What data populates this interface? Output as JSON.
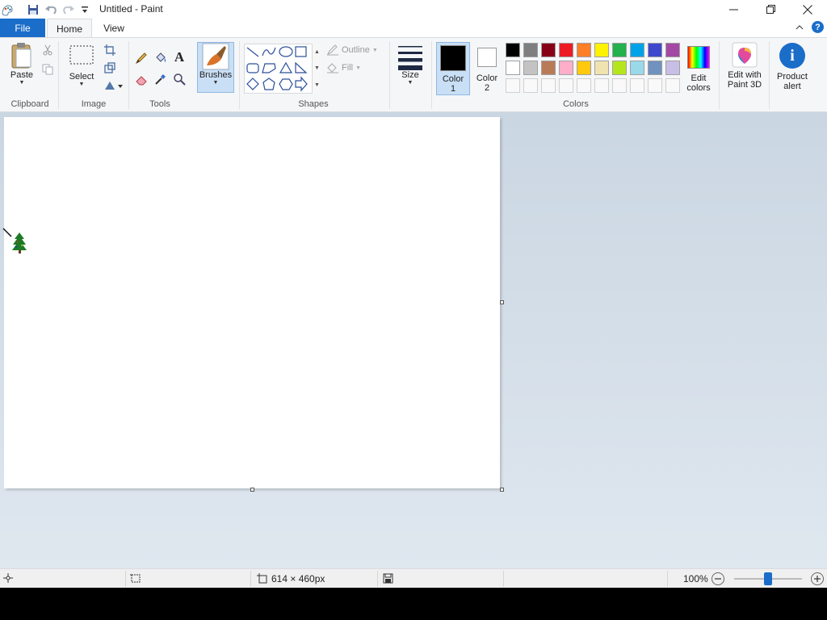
{
  "window": {
    "title": "Untitled - Paint"
  },
  "tabs": {
    "file": "File",
    "home": "Home",
    "view": "View"
  },
  "ribbon": {
    "clipboard": {
      "paste": "Paste",
      "label": "Clipboard"
    },
    "image": {
      "select": "Select",
      "label": "Image"
    },
    "tools": {
      "label": "Tools"
    },
    "brushes": {
      "label": "Brushes"
    },
    "shapes": {
      "outline": "Outline",
      "fill": "Fill",
      "label": "Shapes"
    },
    "size": {
      "label": "Size"
    },
    "colors": {
      "color1": "Color 1",
      "color2": "Color 2",
      "label": "Colors",
      "edit": "Edit colors",
      "color1_value": "#000000",
      "color2_value": "#ffffff",
      "palette_row1": [
        "#000000",
        "#7f7f7f",
        "#880015",
        "#ed1c24",
        "#ff7f27",
        "#fff200",
        "#22b14c",
        "#00a2e8",
        "#3f48cc",
        "#a349a4"
      ],
      "palette_row2": [
        "#ffffff",
        "#c3c3c3",
        "#b97a57",
        "#ffaec9",
        "#ffc90e",
        "#efe4b0",
        "#b5e61d",
        "#99d9ea",
        "#7092be",
        "#c8bfe7"
      ]
    },
    "paint3d": {
      "label": "Edit with Paint 3D"
    },
    "product_alert": {
      "label": "Product alert"
    }
  },
  "statusbar": {
    "dimensions": "614 × 460px",
    "zoom": "100%"
  },
  "colors": {
    "accent": "#1a6dc9",
    "canvas": "#ffffff",
    "workspace": "#cad6e2"
  }
}
